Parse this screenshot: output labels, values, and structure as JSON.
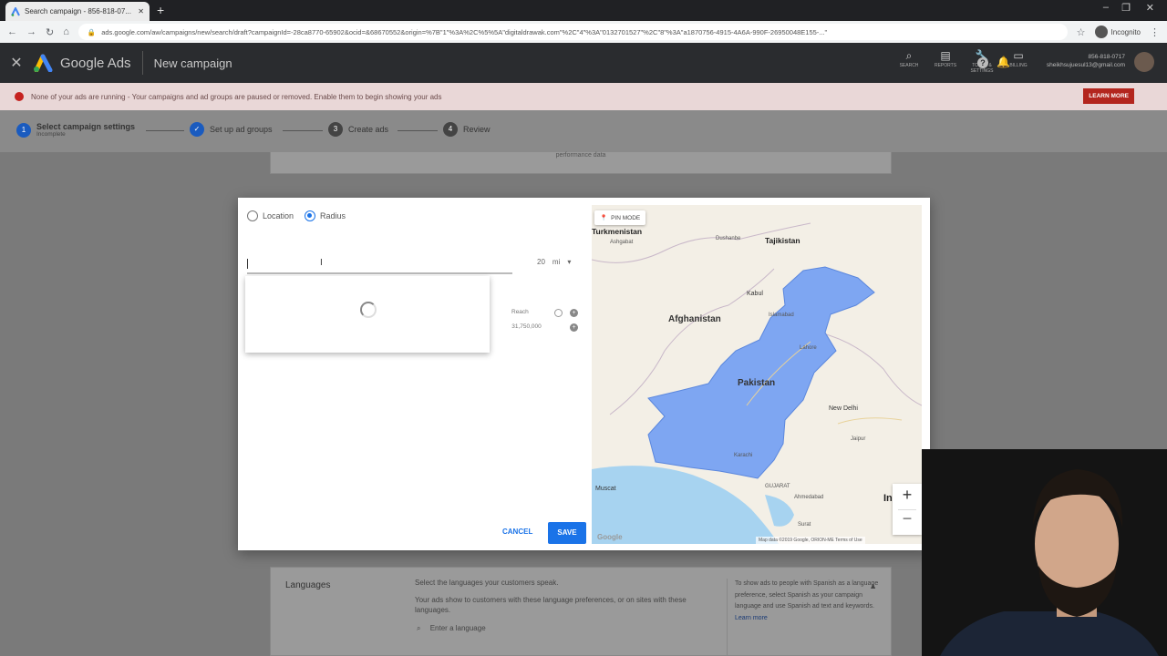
{
  "browser": {
    "tab_title": "Search campaign - 856-818-07...",
    "new_tab": "+",
    "url": "ads.google.com/aw/campaigns/new/search/draft?campaignId=-28ca8770-65902&ocid=&68670552&origin=%7B\"1\"%3A%2C%5%5A\"digitaldrawak.com\"%2C\"4\"%3A\"0132701527\"%2C\"8\"%3A\"a1870756-4915-4A6A-990F-26950048E155-...\"",
    "profile_label": "Incognito",
    "window_controls": [
      "–",
      "❐",
      "✕"
    ]
  },
  "ads_header": {
    "close": "✕",
    "product": "Google Ads",
    "page_title": "New campaign",
    "tools": [
      {
        "icon": "search-icon",
        "glyph": "⌕",
        "label": "SEARCH"
      },
      {
        "icon": "reports-icon",
        "glyph": "▤",
        "label": "REPORTS"
      },
      {
        "icon": "wrench-icon",
        "glyph": "🔧",
        "label": "TOOLS & SETTINGS"
      },
      {
        "icon": "billing-icon",
        "glyph": "▭",
        "label": "BILLING"
      }
    ],
    "help": "?",
    "account_id": "856-818-0717",
    "account_email": "sheikhsujuesul13@gmail.com"
  },
  "alert": {
    "text": "None of your ads are running - Your campaigns and ad groups are paused or removed. Enable them to begin showing your ads",
    "action": "LEARN MORE"
  },
  "stepper": {
    "steps": [
      {
        "num": "1",
        "label": "Select campaign settings",
        "sub": "Incomplete",
        "state": "current"
      },
      {
        "num": "✓",
        "label": "Set up ad groups",
        "sub": "",
        "state": "done"
      },
      {
        "num": "3",
        "label": "Create ads",
        "sub": "",
        "state": "todo"
      },
      {
        "num": "4",
        "label": "Review",
        "sub": "",
        "state": "todo"
      }
    ]
  },
  "background": {
    "top_card_text": "performance data",
    "languages": {
      "title": "Languages",
      "subtitle": "Select the languages your customers speak.",
      "description": "Your ads show to customers with these language preferences, or on sites with these languages.",
      "search_placeholder": "Enter a language",
      "help_text": "To show ads to people with Spanish as a language preference, select Spanish as your campaign language and use Spanish ad text and keywords.",
      "help_link": "Learn more"
    }
  },
  "modal": {
    "radio_options": [
      {
        "label": "Location",
        "selected": false
      },
      {
        "label": "Radius",
        "selected": true
      }
    ],
    "radius_value": "20",
    "radius_unit": "mi",
    "reach_label": "Reach",
    "reach_value": "31,750,000",
    "cancel": "CANCEL",
    "save": "SAVE",
    "map": {
      "pin_mode": "PIN MODE",
      "labels": {
        "turkmenistan": "Turkmenistan",
        "ashgabat": "Ashgabat",
        "dushanbe": "Dushanbe",
        "tajikistan": "Tajikistan",
        "kabul": "Kabul",
        "afghanistan": "Afghanistan",
        "islamabad": "Islamabad",
        "pakistan": "Pakistan",
        "lahore": "Lahore",
        "karachi": "Karachi",
        "new_delhi": "New Delhi",
        "muscat": "Muscat",
        "gujarat": "GUJARAT",
        "ahmedabad": "Ahmedabad",
        "jaipur": "Jaipur",
        "surat": "Surat",
        "in_partial": "In"
      },
      "footer": "Map data ©2019 Google, ORION-ME Terms of Use",
      "logo": "Google",
      "zoom_in": "+",
      "zoom_out": "−"
    }
  },
  "colors": {
    "pakistan_fill": "#7ea6f2",
    "water": "#a7d3f0",
    "primary": "#1a73e8",
    "alert_btn": "#b3261e"
  }
}
